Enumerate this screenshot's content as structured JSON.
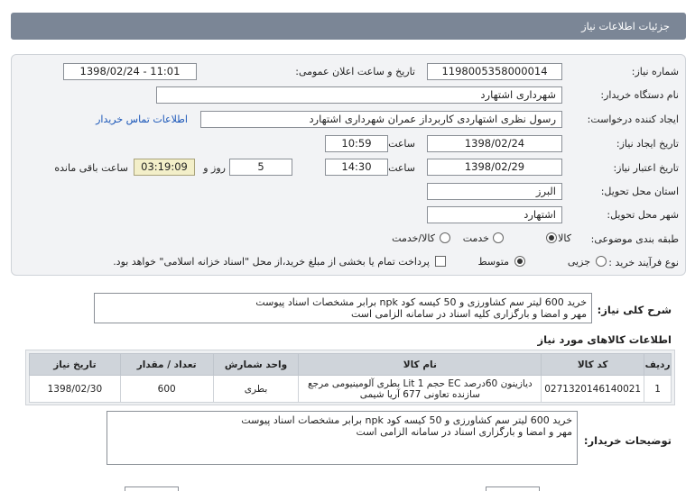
{
  "header": {
    "title": "جزئیات اطلاعات نیاز"
  },
  "form": {
    "need_number_label": "شماره نیاز:",
    "need_number": "1198005358000014",
    "announce_label": "تاریخ و ساعت اعلان عمومی:",
    "announce_value": "1398/02/24 - 11:01",
    "buyer_org_label": "نام دستگاه خریدار:",
    "buyer_org": "شهرداری اشتهارد",
    "requester_label": "ایجاد کننده درخواست:",
    "requester": "رسول نظری اشتهاردی کاربرداز عمران شهرداری اشتهارد",
    "contact_link": "اطلاعات تماس خریدار",
    "created_label": "تاریخ ایجاد نیاز:",
    "created_date": "1398/02/24",
    "time_label": "ساعت",
    "created_time": "10:59",
    "validity_label": "تاریخ اعتبار نیاز:",
    "validity_date": "1398/02/29",
    "validity_time": "14:30",
    "days_value": "5",
    "days_label": "روز و",
    "remaining_value": "03:19:09",
    "remaining_label": "ساعت باقی مانده",
    "province_label": "استان محل تحویل:",
    "province": "البرز",
    "city_label": "شهر محل تحویل:",
    "city": "اشتهارد",
    "category_label": "طبقه بندی موضوعی:",
    "category_options": [
      "کالا",
      "خدمت",
      "کالا/خدمت"
    ],
    "category_selected": 0,
    "process_label": "نوع فرآیند خرید :",
    "process_options": [
      "جزیی",
      "متوسط"
    ],
    "process_selected": 1,
    "payment_note": "پرداخت تمام یا بخشی از مبلغ خرید،از محل \"اسناد خزانه اسلامی\" خواهد بود."
  },
  "summary": {
    "label": "شرح کلی نیاز:",
    "line1": "خرید 600 لیتر سم کشاورزی و 50 کیسه کود npk برابر مشخصات اسناد پیوست",
    "line2": "مهر و امضا و بارگزاری کلیه اسناد در سامانه الزامی است"
  },
  "goods": {
    "title": "اطلاعات کالاهای مورد نیاز",
    "columns": [
      "ردیف",
      "کد کالا",
      "نام کالا",
      "واحد شمارش",
      "تعداد / مقدار",
      "تاریخ نیاز"
    ],
    "rows": [
      {
        "row": "1",
        "code": "0271320146140021",
        "name_line1": "دیازینون 60درصد EC حجم 1 Lit بطری آلومینیومی مرجع",
        "name_line2": "سازنده تعاونی 677 آریا شیمی",
        "unit": "بطری",
        "qty": "600",
        "date": "1398/02/30"
      }
    ]
  },
  "buyer_notes": {
    "label": "توضیحات خریدار:",
    "line1": "خرید 600 لیتر سم کشاورزی و 50 کیسه کود npk برابر مشخصات اسناد پیوست",
    "line2": "مهر و امضا و بارگزاری اسناد در سامانه الزامی است"
  }
}
